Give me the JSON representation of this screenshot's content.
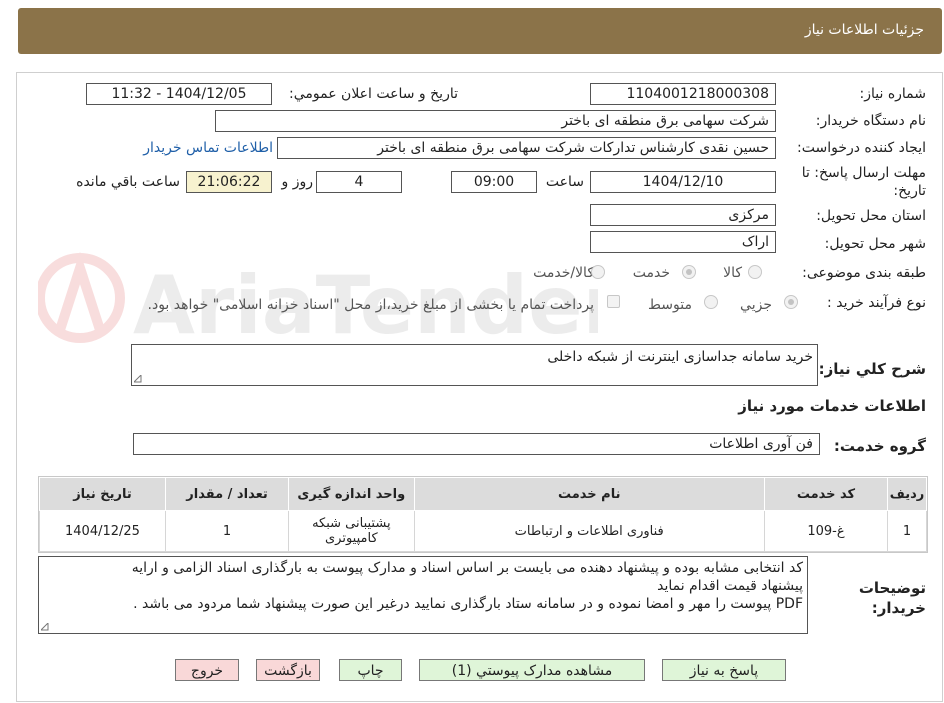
{
  "header": {
    "title": "جزئیات اطلاعات نیاز"
  },
  "watermark": {
    "text": "AriaTender.neT"
  },
  "form": {
    "need_number_label": "شماره نیاز:",
    "need_number": "1104001218000308",
    "announce_label": "تاریخ و ساعت اعلان عمومي:",
    "announce_value": "1404/12/05 - 11:32",
    "buyer_label": "نام دستگاه خریدار:",
    "buyer_value": "شرکت سهامی برق منطقه ای باختر",
    "requester_label": "ایجاد کننده درخواست:",
    "requester_value": "حسین نقدی کارشناس تدارکات شرکت سهامی برق منطقه ای باختر",
    "contact_link": "اطلاعات تماس خریدار",
    "deadline_label": "مهلت ارسال پاسخ: تا تاریخ:",
    "deadline_date": "1404/12/10",
    "time_label": "ساعت",
    "deadline_time": "09:00",
    "days_value": "4",
    "days_label": "روز و",
    "remaining_time": "21:06:22",
    "remaining_label": "ساعت باقي مانده",
    "province_label": "استان محل تحویل:",
    "province_value": "مرکزی",
    "city_label": "شهر محل تحویل:",
    "city_value": "اراک",
    "category_label": "طبقه بندی موضوعی:",
    "category_options": [
      "کالا",
      "خدمت",
      "کالا/خدمت"
    ],
    "category_selected": "خدمت",
    "process_label": "نوع فرآیند خرید :",
    "process_options": [
      "جزیي",
      "متوسط"
    ],
    "process_selected": "جزیي",
    "payment_note": "پرداخت تمام یا بخشی از مبلغ خرید،از محل \"اسناد خزانه اسلامی\" خواهد بود.",
    "description_label": "شرح کلي نیاز:",
    "description_value": "خرید سامانه جداسازی اینترنت از شبکه داخلی",
    "services_title": "اطلاعات خدمات مورد نیاز",
    "service_group_label": "گروه خدمت:",
    "service_group_value": "فن آوری اطلاعات"
  },
  "table": {
    "headers": [
      "ردیف",
      "کد خدمت",
      "نام خدمت",
      "واحد اندازه گیری",
      "تعداد / مقدار",
      "تاریخ نیاز"
    ],
    "rows": [
      [
        "1",
        "غ-109",
        "فناوری اطلاعات و ارتباطات",
        "پشتیبانی شبکه کامپیوتری",
        "1",
        "1404/12/25"
      ]
    ]
  },
  "buyer_notes": {
    "label": "توضیحات خریدار:",
    "line1": "کد انتخابی مشابه بوده و پیشنهاد دهنده می بایست بر اساس اسناد و مدارک پیوست به بارگذاری اسناد الزامی و ارایه",
    "line2": "پیشنهاد قیمت اقدام نماید",
    "line3": "PDF پیوست را مهر و امضا نموده و در سامانه ستاد بارگذاری نمایید درغیر این صورت پیشنهاد شما مردود می باشد ."
  },
  "buttons": {
    "reply": "پاسخ به نیاز",
    "attachments": "مشاهده مدارک پیوستي (1)",
    "print": "چاپ",
    "back": "بازگشت",
    "exit": "خروج"
  },
  "colors": {
    "header_bg": "#8b7349",
    "highlight_bg": "#f7f2cf",
    "link": "#1f5fa8",
    "green_button": "#dff5d8",
    "pink_button": "#f9d8d8"
  }
}
